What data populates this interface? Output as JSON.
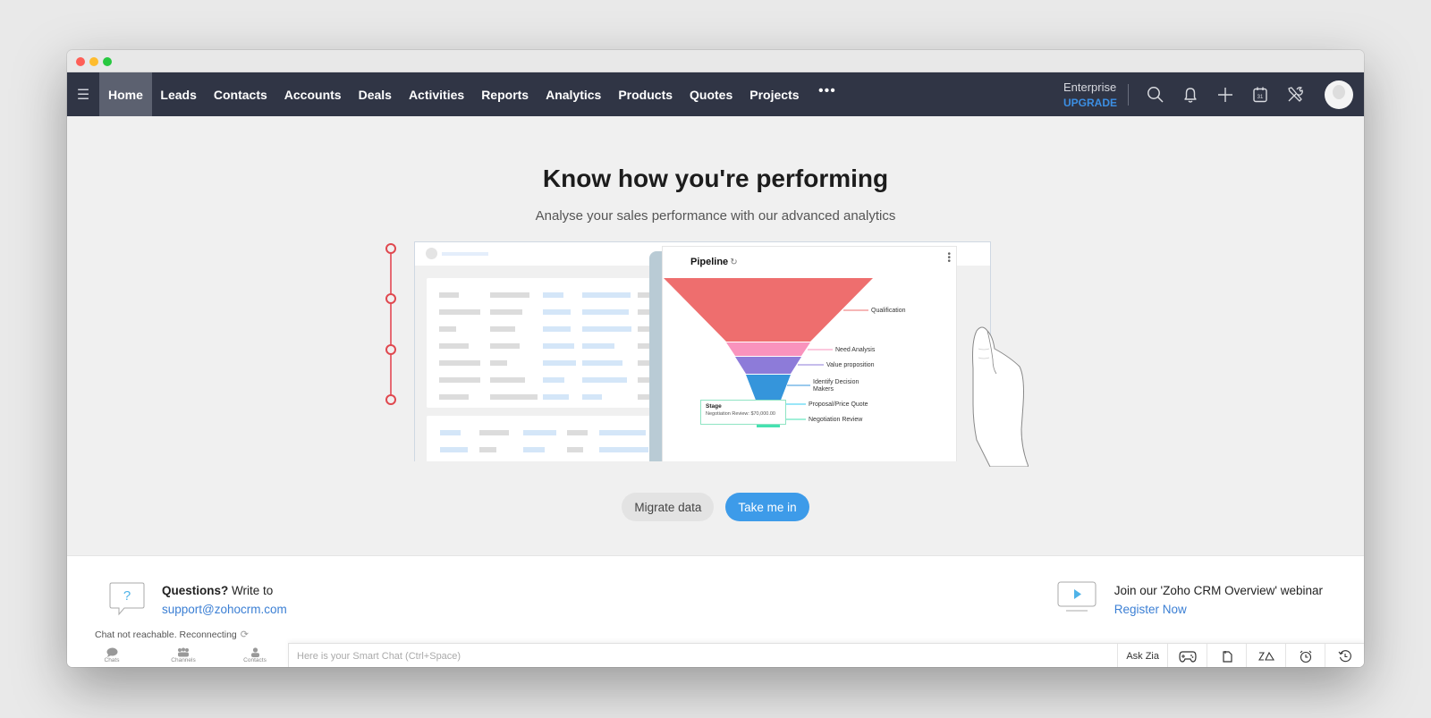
{
  "window": {
    "controls": [
      "close",
      "minimize",
      "maximize"
    ]
  },
  "navbar": {
    "menu_icon": "hamburger-icon",
    "items": [
      {
        "label": "Home",
        "active": true
      },
      {
        "label": "Leads"
      },
      {
        "label": "Contacts"
      },
      {
        "label": "Accounts"
      },
      {
        "label": "Deals"
      },
      {
        "label": "Activities"
      },
      {
        "label": "Reports"
      },
      {
        "label": "Analytics"
      },
      {
        "label": "Products"
      },
      {
        "label": "Quotes"
      },
      {
        "label": "Projects"
      }
    ],
    "more_label": "•••",
    "plan_name": "Enterprise",
    "upgrade_label": "UPGRADE",
    "icons": [
      "search-icon",
      "bell-icon",
      "plus-icon",
      "calendar-icon",
      "tools-icon"
    ],
    "calendar_day": "31"
  },
  "hero": {
    "title": "Know how you're performing",
    "subtitle": "Analyse your sales performance with our advanced analytics"
  },
  "illustration": {
    "chart_title": "Pipeline",
    "funnel_stages": [
      {
        "label": "Qualification",
        "color": "#ee6e6e"
      },
      {
        "label": "Need Analysis",
        "color": "#f993bd"
      },
      {
        "label": "Value proposition",
        "color": "#8d7bd9"
      },
      {
        "label": "Identify Decision Makers",
        "color": "#3595db"
      },
      {
        "label": "Proposal/Price Quote",
        "color": "#33ccf2"
      },
      {
        "label": "Negotiation Review",
        "color": "#45e1b0"
      }
    ],
    "tooltip": {
      "title": "Stage",
      "value": "Negotiation Review: $70,000.00"
    }
  },
  "actions": {
    "migrate_label": "Migrate data",
    "enter_label": "Take me in"
  },
  "footer": {
    "help_bold": "Questions?",
    "help_text": " Write to",
    "help_email": "support@zohocrm.com",
    "webinar_text": "Join our 'Zoho CRM Overview' webinar",
    "webinar_link": "Register Now"
  },
  "chat": {
    "status": "Chat not reachable. Reconnecting",
    "tabs": [
      {
        "label": "Chats",
        "icon": "chat-bubble-icon"
      },
      {
        "label": "Channels",
        "icon": "channels-icon"
      },
      {
        "label": "Contacts",
        "icon": "contact-icon"
      }
    ],
    "placeholder": "Here is your Smart Chat (Ctrl+Space)",
    "ask_zia": "Ask Zia",
    "tools": [
      "gamepad-icon",
      "notes-icon",
      "zia-icon",
      "alarm-icon",
      "history-icon"
    ]
  },
  "colors": {
    "navbar_bg": "#303545",
    "accent": "#3d9be9",
    "upgrade": "#3c8fe4",
    "link": "#3b7fd4"
  }
}
